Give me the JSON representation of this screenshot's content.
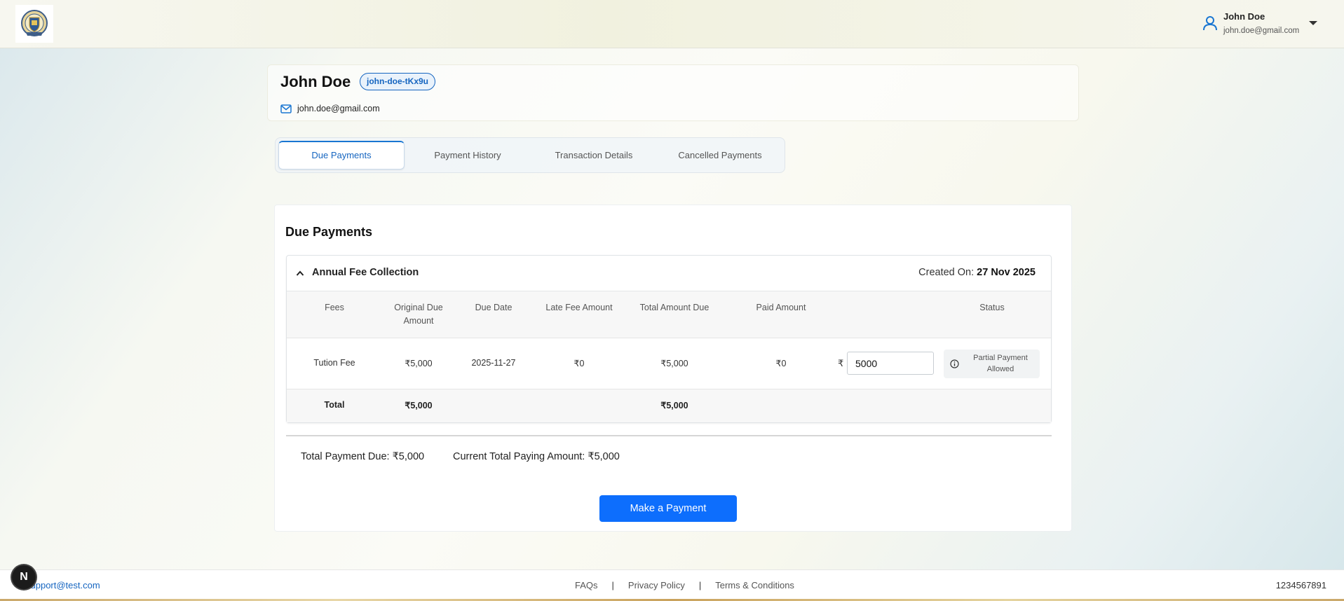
{
  "header": {
    "user_name": "John Doe",
    "user_email": "john.doe@gmail.com"
  },
  "profile": {
    "name": "John Doe",
    "slug": "john-doe-tKx9u",
    "email": "john.doe@gmail.com"
  },
  "tabs": [
    {
      "label": "Due Payments",
      "active": true
    },
    {
      "label": "Payment History",
      "active": false
    },
    {
      "label": "Transaction Details",
      "active": false
    },
    {
      "label": "Cancelled Payments",
      "active": false
    }
  ],
  "due": {
    "title": "Due Payments",
    "collection": {
      "name": "Annual Fee Collection",
      "created_label": "Created On:",
      "created_date": "27 Nov 2025"
    },
    "columns": [
      "Fees",
      "Original Due Amount",
      "Due Date",
      "Late Fee Amount",
      "Total Amount Due",
      "Paid Amount",
      "Status"
    ],
    "row": {
      "fee": "Tution Fee",
      "original": "₹5,000",
      "due_date": "2025-11-27",
      "late_fee": "₹0",
      "total_due": "₹5,000",
      "paid": "₹0",
      "currency": "₹",
      "paying_value": "5000",
      "status": "Partial Payment Allowed"
    },
    "totals": {
      "label": "Total",
      "original": "₹5,000",
      "total_due": "₹5,000"
    },
    "summary": {
      "total_payment_due": "Total Payment Due: ₹5,000",
      "current_paying": "Current Total Paying Amount: ₹5,000"
    },
    "pay_button": "Make a Payment"
  },
  "footer": {
    "email": "support@test.com",
    "links": [
      "FAQs",
      "Privacy Policy",
      "Terms & Conditions"
    ],
    "separator": "|",
    "phone": "1234567891"
  },
  "fab_label": "N",
  "colors": {
    "accent": "#1565c0",
    "button": "#0d6efd"
  }
}
